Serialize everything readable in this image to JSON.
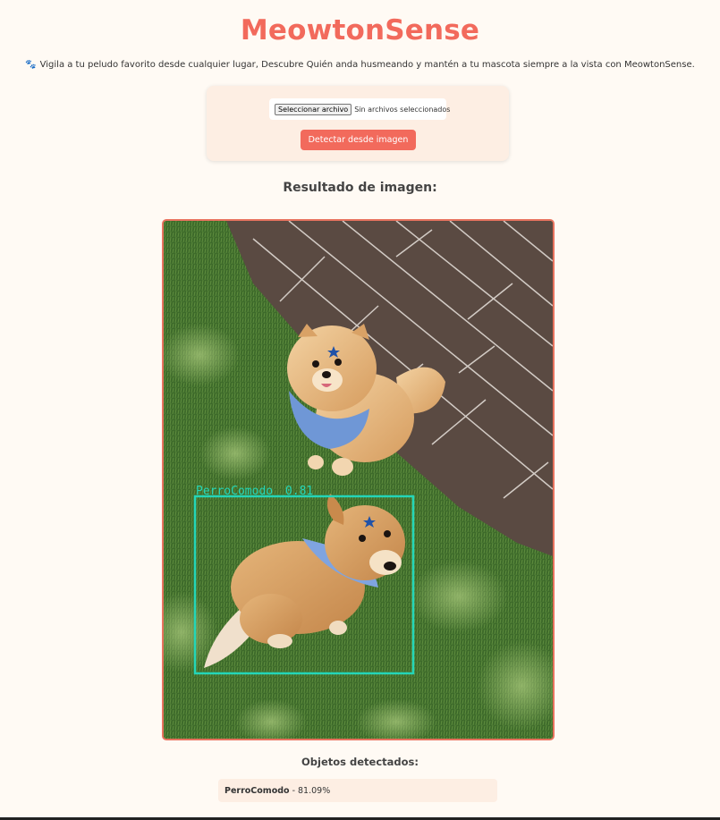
{
  "app": {
    "title": "MeowtonSense",
    "tagline": "Vigila a tu peludo favorito desde cualquier lugar, Descubre Quién anda husmeando y mantén a tu mascota siempre a la vista con MeowtonSense.",
    "tagline_icon": "paw-prints-icon"
  },
  "upload": {
    "file_button_label": "Seleccionar archivo",
    "file_status": "Sin archivos seleccionados",
    "detect_button_label": "Detectar desde imagen"
  },
  "result": {
    "heading": "Resultado de imagen:",
    "image_alt": "Dos perros con pañuelos azules sentados en césped junto a un piso de madera",
    "detection_overlay": {
      "label": "PerroComodo",
      "confidence_text": "0.81",
      "color": "#24d6b8"
    }
  },
  "detected_objects": {
    "heading": "Objetos detectados:",
    "items": [
      {
        "name": "PerroComodo",
        "separator": "-",
        "confidence": "81.09%"
      }
    ]
  },
  "colors": {
    "accent": "#f26a5c",
    "background": "#fffaf4",
    "card": "#fdeee3",
    "detection_box": "#24d6b8"
  }
}
